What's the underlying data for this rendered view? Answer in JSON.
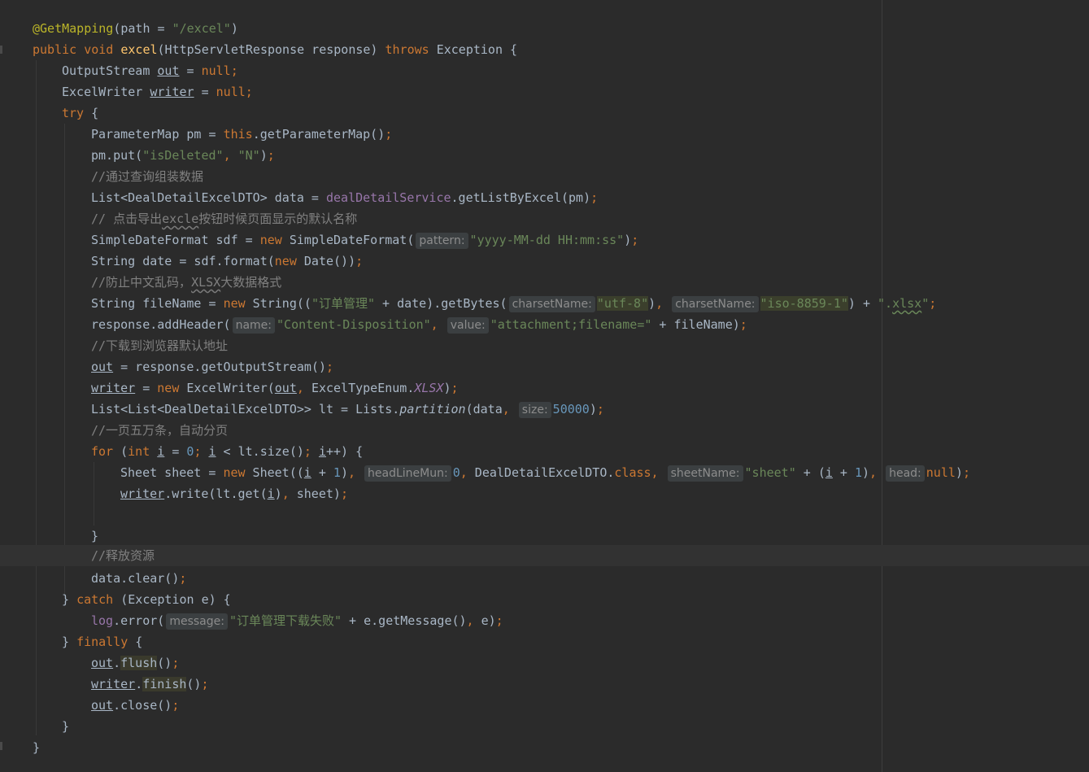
{
  "colors": {
    "background": "#2b2b2b",
    "keyword": "#cc7832",
    "string": "#6a8759",
    "number": "#6897bb",
    "comment": "#808080",
    "annotation": "#bbb529",
    "method_decl": "#ffc66d",
    "field": "#9876aa",
    "default_text": "#a9b7c6"
  },
  "code": {
    "l01": {
      "annotation": "@GetMapping",
      "a": "(path = ",
      "s": "\"/excel\"",
      "b": ")"
    },
    "l02": {
      "k1": "public",
      "k2": "void",
      "name": "excel",
      "a": "(HttpServletResponse response) ",
      "k3": "throws",
      "b": " Exception {"
    },
    "l03": {
      "a": "OutputStream ",
      "v": "out",
      "b": " = ",
      "k": "null",
      "c": ";"
    },
    "l04": {
      "a": "ExcelWriter ",
      "v": "writer",
      "b": " = ",
      "k": "null",
      "c": ";"
    },
    "l05": {
      "k": "try",
      "a": " {"
    },
    "l06": {
      "a": "ParameterMap pm = ",
      "k": "this",
      "b": ".getParameterMap()",
      "c": ";"
    },
    "l07": {
      "a": "pm.put(",
      "s1": "\"isDeleted\"",
      "c1": ", ",
      "s2": "\"N\"",
      "b": ")",
      "c2": ";"
    },
    "l08": {
      "cm": "//通过查询组装数据"
    },
    "l09": {
      "a": "List<DealDetailExcelDTO> data = ",
      "f": "dealDetailService",
      "b": ".getListByExcel(pm)",
      "c": ";"
    },
    "l10": {
      "cm1": "// 点击导出",
      "cm2": "excle",
      "cm3": "按钮时候页面显示的默认名称"
    },
    "l11": {
      "a": "SimpleDateFormat sdf = ",
      "k": "new",
      "b": " SimpleDateFormat(",
      "hint": "pattern:",
      "s": "\"yyyy-MM-dd HH:mm:ss\"",
      "c": ")",
      "d": ";"
    },
    "l12": {
      "a": "String date = sdf.format(",
      "k": "new",
      "b": " Date())",
      "c": ";"
    },
    "l13": {
      "cm1": "//防止中文乱码，",
      "cm2": "XLSX",
      "cm3": "大数据格式"
    },
    "l14": {
      "a": "String fileName = ",
      "k": "new",
      "b": " String((",
      "s1": "\"订单管理\"",
      "c": " + date).getBytes(",
      "h1": "charsetName:",
      "s2": "\"utf-8\"",
      "d": ")",
      "e": ", ",
      "h2": "charsetName:",
      "s3": "\"iso-8859-1\"",
      "f": ") + ",
      "s4a": "\".",
      "s4b": "xlsx",
      "s4c": "\"",
      "g": ";"
    },
    "l15": {
      "a": "response.addHeader(",
      "h1": "name:",
      "s1": "\"Content-Disposition\"",
      "c": ", ",
      "h2": "value:",
      "s2": "\"attachment;filename=\"",
      "b": " + fileName)",
      "d": ";"
    },
    "l16": {
      "cm": "//下载到浏览器默认地址"
    },
    "l17": {
      "v": "out",
      "a": " = response.getOutputStream()",
      "c": ";"
    },
    "l18": {
      "v": "writer",
      "a": " = ",
      "k": "new",
      "b": " ExcelWriter(",
      "v2": "out",
      "c": ", ",
      "d": "ExcelTypeEnum.",
      "f": "XLSX",
      "e": ")",
      "g": ";"
    },
    "l19": {
      "a": "List<List<DealDetailExcelDTO>> lt = Lists.",
      "m": "partition",
      "b": "(data",
      "c": ", ",
      "hint": "size:",
      "n": "50000",
      "d": ")",
      "e": ";"
    },
    "l20": {
      "cm": "//一页五万条，自动分页"
    },
    "l21": {
      "k1": "for",
      "a": " (",
      "k2": "int",
      "b": " ",
      "i1": "i",
      "c": " = ",
      "n": "0",
      "s1": "; ",
      "i2": "i",
      "d": " < lt.size()",
      "s2": "; ",
      "i3": "i",
      "e": "++) {"
    },
    "l22": {
      "a": "Sheet sheet = ",
      "k": "new",
      "b": " Sheet((",
      "i1": "i",
      "c": " + ",
      "n1": "1",
      "d": ")",
      "s1": ", ",
      "h1": "headLineMun:",
      "n2": "0",
      "s2": ", ",
      "e": "DealDetailExcelDTO.",
      "k2": "class",
      "s3": ", ",
      "h2": "sheetName:",
      "st": "\"sheet\"",
      "f": " + (",
      "i2": "i",
      "g": " + ",
      "n3": "1",
      "h": ")",
      "s4": ", ",
      "h3": "head:",
      "k3": "null",
      "j": ")",
      "s5": ";"
    },
    "l23": {
      "v": "writer",
      "a": ".write(lt.get(",
      "i": "i",
      "b": ")",
      "c": ", ",
      "d": "sheet)",
      "e": ";"
    },
    "l25": {
      "a": "}"
    },
    "l26": {
      "cm": "//释放资源"
    },
    "l27": {
      "a": "data.clear()",
      "c": ";"
    },
    "l28": {
      "a": "} ",
      "k": "catch",
      "b": " (Exception e) {"
    },
    "l29": {
      "f": "log",
      "a": ".error(",
      "hint": "message:",
      "s": "\"订单管理下载失败\"",
      "b": " + e.getMessage()",
      "c": ", ",
      "d": "e)",
      "e": ";"
    },
    "l30": {
      "a": "} ",
      "k": "finally",
      "b": " {"
    },
    "l31": {
      "v": "out",
      "a": ".",
      "m": "flush",
      "b": "()",
      "c": ";"
    },
    "l32": {
      "v": "writer",
      "a": ".",
      "m": "finish",
      "b": "()",
      "c": ";"
    },
    "l33": {
      "v": "out",
      "a": ".close()",
      "c": ";"
    },
    "l34": {
      "a": "}"
    },
    "l35": {
      "a": "}"
    }
  }
}
